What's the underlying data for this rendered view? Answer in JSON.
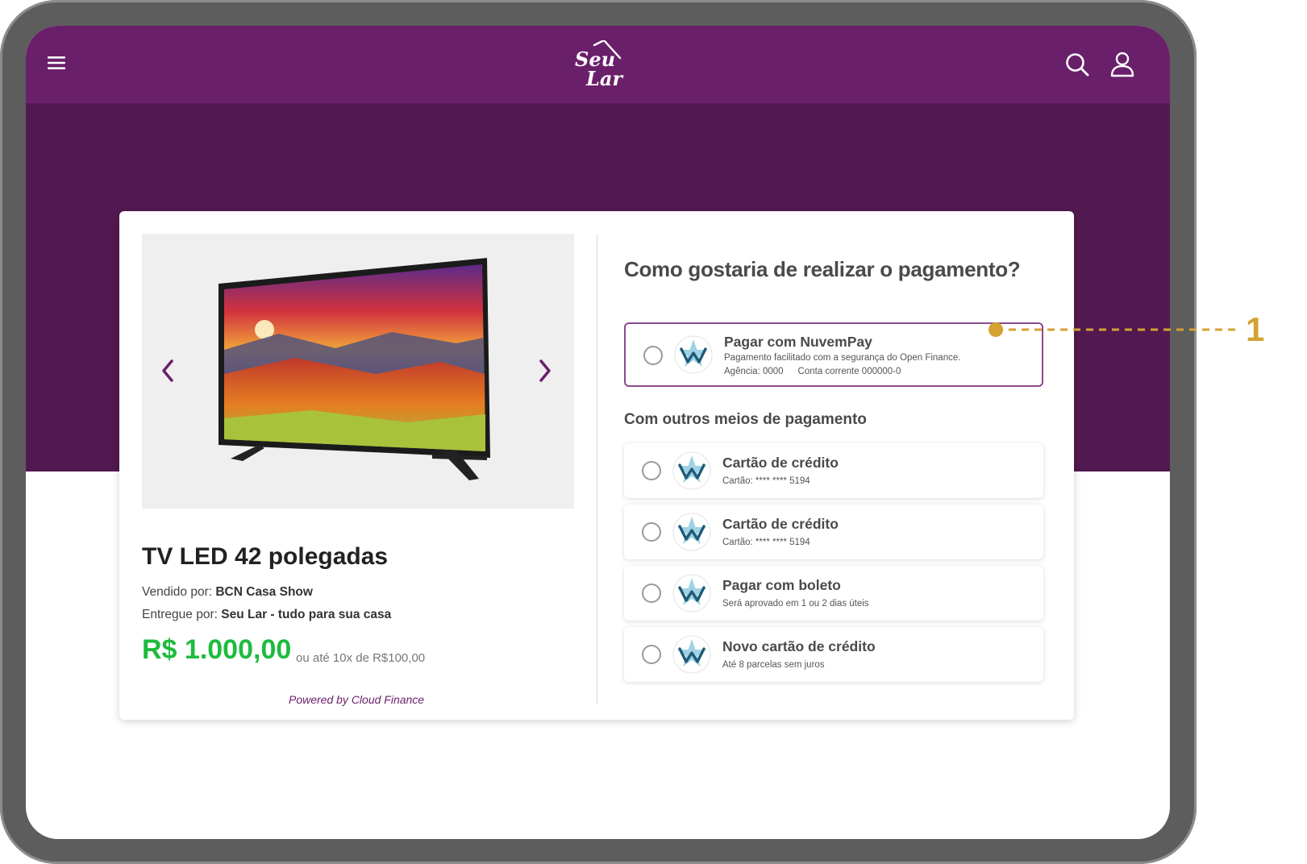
{
  "header": {
    "logo_alt": "Seu Lar",
    "icons": [
      "menu-icon",
      "search-icon",
      "user-icon"
    ]
  },
  "product": {
    "title": "TV LED 42 polegadas",
    "sold_by_label": "Vendido por:",
    "sold_by_value": "BCN Casa Show",
    "delivered_by_label": "Entregue por:",
    "delivered_by_value": "Seu Lar - tudo para sua casa",
    "price": "R$ 1.000,00",
    "installments": "ou até 10x de R$100,00",
    "powered_by": "Powered by Cloud Finance"
  },
  "payment": {
    "title": "Como gostaria de realizar o pagamento?",
    "primary": {
      "title": "Pagar com NuvemPay",
      "subtitle": "Pagamento facilitado com a segurança do Open Finance.",
      "agency": "Agência: 0000",
      "account": "Conta corrente 000000-0"
    },
    "other_title": "Com outros meios de pagamento",
    "options": [
      {
        "title": "Cartão de crédito",
        "subtitle": "Cartão: **** **** 5194"
      },
      {
        "title": "Cartão de crédito",
        "subtitle": "Cartão: **** **** 5194"
      },
      {
        "title": "Pagar com boleto",
        "subtitle": "Será aprovado em 1 ou 2 dias úteis"
      },
      {
        "title": "Novo cartão de crédito",
        "subtitle": "Até 8 parcelas sem juros"
      }
    ]
  },
  "annotation": {
    "number": "1"
  },
  "colors": {
    "brand_purple": "#6a1f6b",
    "band_purple": "#521950",
    "price_green": "#1ebb3d",
    "callout_gold": "#d3a232"
  }
}
